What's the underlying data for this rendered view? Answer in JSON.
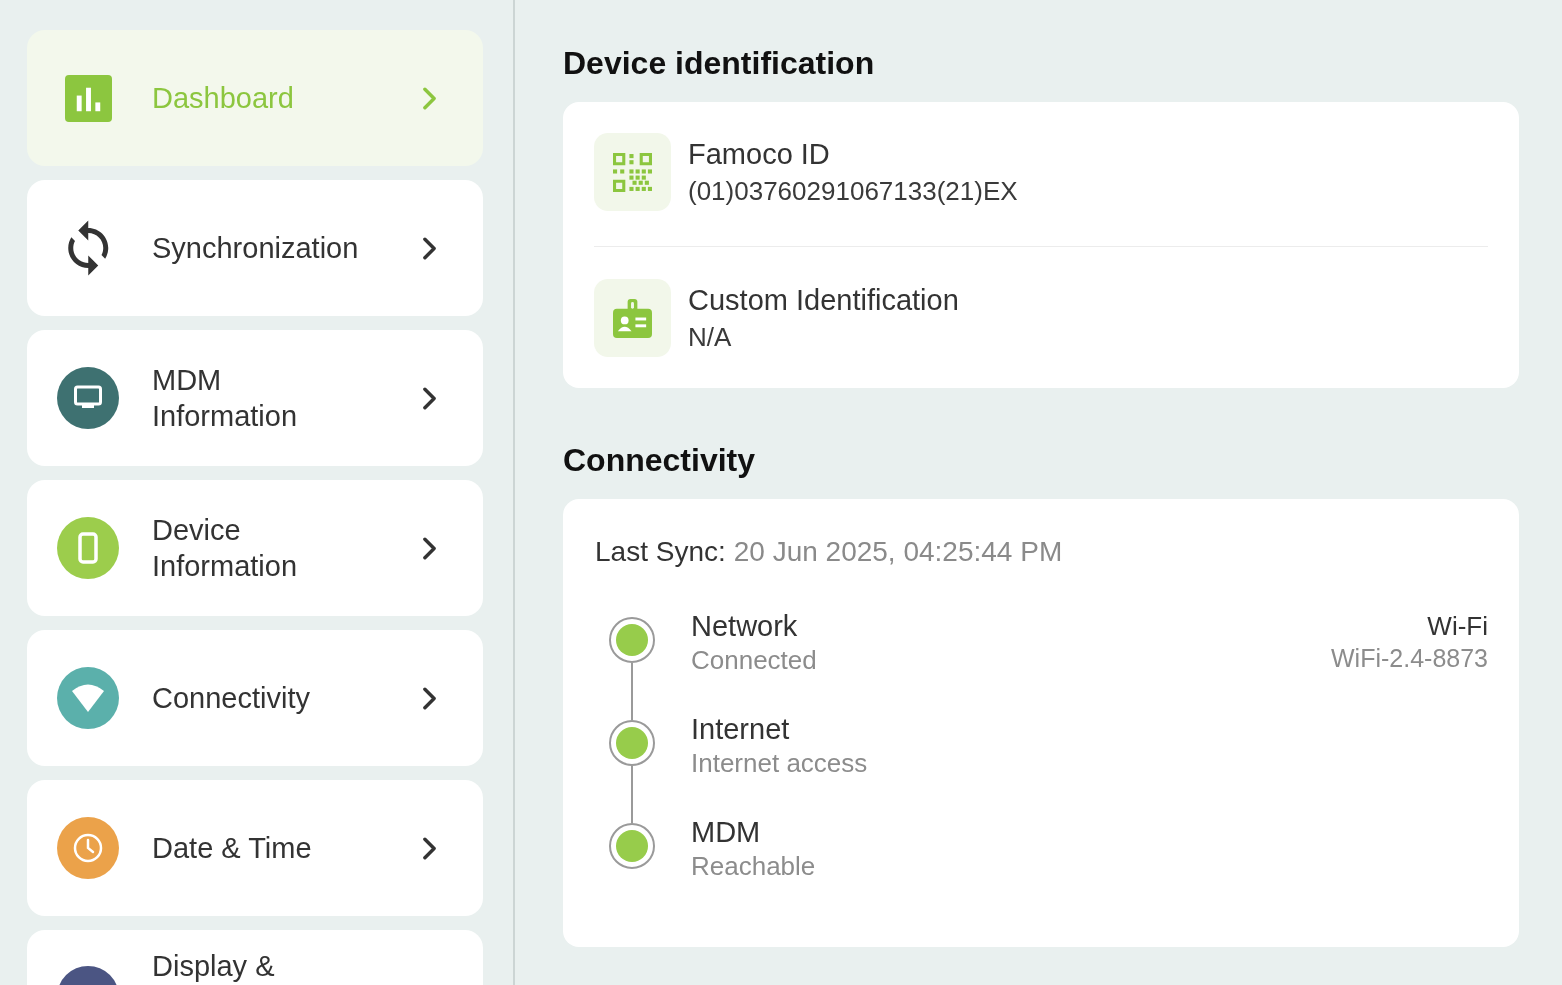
{
  "sidebar": {
    "items": [
      {
        "label": "Dashboard",
        "selected": true
      },
      {
        "label": "Synchronization",
        "selected": false
      },
      {
        "label": "MDM\nInformation",
        "selected": false
      },
      {
        "label": "Device\nInformation",
        "selected": false
      },
      {
        "label": "Connectivity",
        "selected": false
      },
      {
        "label": "Date & Time",
        "selected": false
      },
      {
        "label": "Display &",
        "selected": false
      }
    ]
  },
  "device_identification": {
    "title": "Device identification",
    "rows": [
      {
        "title": "Famoco ID",
        "value": "(01)03760291067133(21)EX"
      },
      {
        "title": "Custom Identification",
        "value": "N/A"
      }
    ]
  },
  "connectivity": {
    "title": "Connectivity",
    "last_sync_label": "Last Sync:",
    "last_sync_value": "20 Jun 2025, 04:25:44 PM",
    "statuses": [
      {
        "title": "Network",
        "state": "Connected",
        "color": "#97cc4b",
        "detail_title": "Wi-Fi",
        "detail_value": "WiFi-2.4-8873"
      },
      {
        "title": "Internet",
        "state": "Internet access",
        "color": "#97cc4b"
      },
      {
        "title": "MDM",
        "state": "Reachable",
        "color": "#97cc4b"
      }
    ]
  }
}
